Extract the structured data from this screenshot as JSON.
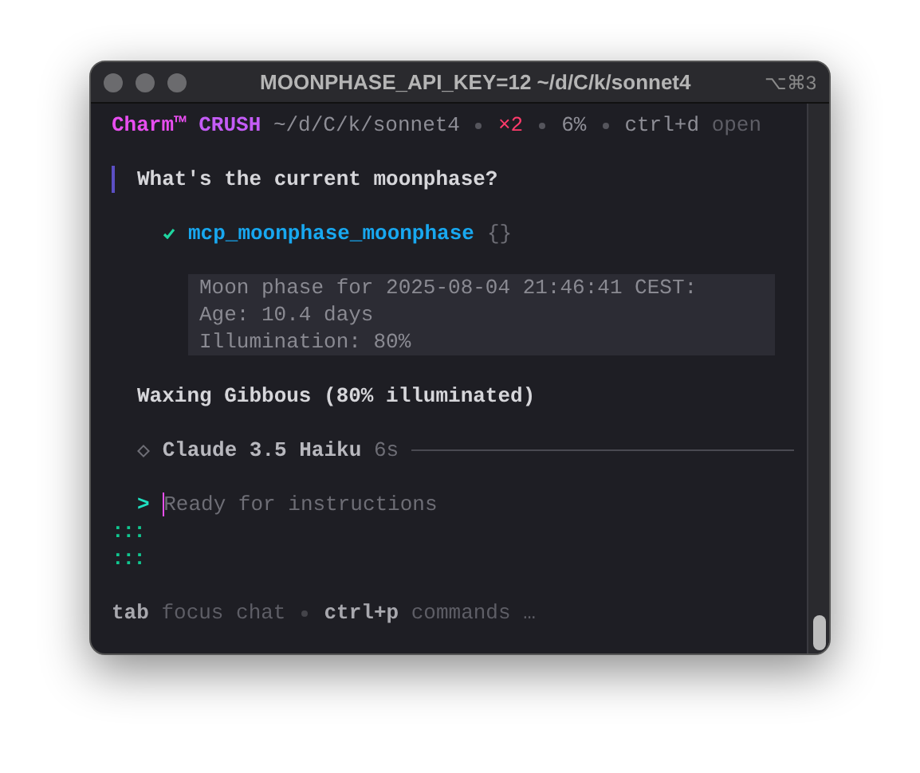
{
  "window": {
    "title": "MOONPHASE_API_KEY=12 ~/d/C/k/sonnet4",
    "shortcut": "⌥⌘3"
  },
  "header": {
    "brand": "Charm™",
    "app": "CRUSH",
    "path": "~/d/C/k/sonnet4",
    "errors": "×2",
    "context": "6%",
    "key": "ctrl+d",
    "action": "open"
  },
  "user_message": "What's the current moonphase?",
  "tool_call": {
    "done": true,
    "name": "mcp_moonphase_moonphase",
    "args": "{}",
    "output": [
      "Moon phase for 2025-08-04 21:46:41 CEST:",
      "Age: 10.4 days",
      "Illumination: 80%"
    ]
  },
  "answer": "Waxing Gibbous (80% illuminated)",
  "model": {
    "name": "Claude 3.5 Haiku",
    "duration": "6s"
  },
  "input": {
    "prompt": ">",
    "placeholder": "Ready for instructions"
  },
  "spinner": [
    ":::",
    ":::"
  ],
  "help": [
    {
      "key": "tab",
      "label": "focus chat"
    },
    {
      "key": "ctrl+p",
      "label": "commands …"
    }
  ]
}
